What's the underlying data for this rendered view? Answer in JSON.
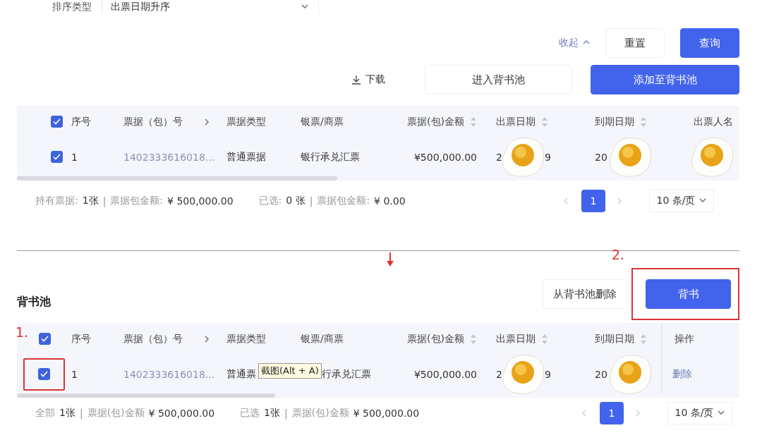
{
  "sort": {
    "label": "排序类型",
    "value": "出票日期升序"
  },
  "query_actions": {
    "collapse": "收起",
    "reset": "重置",
    "search": "查询"
  },
  "list_actions": {
    "download": "下载",
    "enter_pool": "进入背书池",
    "add_to_pool": "添加至背书池"
  },
  "bills_table": {
    "header_checked": true,
    "columns": [
      {
        "label": "序号",
        "kind": "plain"
      },
      {
        "label": "票据（包）号",
        "kind": "expandable"
      },
      {
        "label": "票据类型",
        "kind": "plain"
      },
      {
        "label": "银票/商票",
        "kind": "plain"
      },
      {
        "label": "票据(包)金额",
        "kind": "sortable"
      },
      {
        "label": "出票日期",
        "kind": "sortable"
      },
      {
        "label": "到期日期",
        "kind": "sortable"
      },
      {
        "label": "出票人名",
        "kind": "plain"
      }
    ],
    "rows": [
      {
        "checked": true,
        "seq": "1",
        "bill_no": "1402333616018...",
        "type": "普通票据",
        "bank": "银行承兑汇票",
        "amount": "¥500,000.00",
        "issue_date": {
          "start": "2",
          "end": "9"
        },
        "due_date": "20"
      }
    ],
    "summary": [
      {
        "label": "持有票据:",
        "value": "1张"
      },
      {
        "label": "票据包金额:",
        "value": "¥ 500,000.00"
      },
      {
        "label": "已选:",
        "value": "0 张"
      },
      {
        "label": "票据包金额:",
        "value": "¥ 0.00"
      }
    ],
    "separator": "|",
    "pagination": {
      "pages": [
        {
          "label": "1",
          "selected": true
        }
      ],
      "page_size": "10 条/页"
    }
  },
  "annotations": {
    "arrow": true,
    "step_one": "1.",
    "step_two": "2."
  },
  "pool": {
    "title": "背书池",
    "remove": "从背书池删除",
    "endorse": "背书",
    "header_checked": true,
    "columns": [
      {
        "label": "序号",
        "kind": "plain"
      },
      {
        "label": "票据（包）号",
        "kind": "expandable"
      },
      {
        "label": "票据类型",
        "kind": "plain"
      },
      {
        "label": "银票/商票",
        "kind": "plain"
      },
      {
        "label": "票据(包)金额",
        "kind": "sortable"
      },
      {
        "label": "出票日期",
        "kind": "sortable"
      },
      {
        "label": "到期日期",
        "kind": "sortable"
      },
      {
        "label": "操作",
        "kind": "plain"
      }
    ],
    "rows": [
      {
        "checked": true,
        "seq": "1",
        "bill_no": "1402333616018...",
        "type": "普通票",
        "bank": "行承兑汇票",
        "amount": "¥500,000.00",
        "issue_date": {
          "start": "2",
          "end": "9"
        },
        "due_date": "20",
        "action": "删除"
      }
    ],
    "tooltip": "截图(Alt + A)",
    "separator": "|",
    "summary": [
      {
        "label": "全部",
        "value": "1张"
      },
      {
        "label": "票据(包)金额",
        "value": "¥ 500,000.00"
      },
      {
        "label": "已选",
        "value": "1张"
      },
      {
        "label": "票据(包)金额",
        "value": "¥ 500,000.00"
      }
    ],
    "pagination": {
      "pages": [
        {
          "label": "1",
          "selected": true
        }
      ],
      "page_size": "10 条/页"
    }
  }
}
